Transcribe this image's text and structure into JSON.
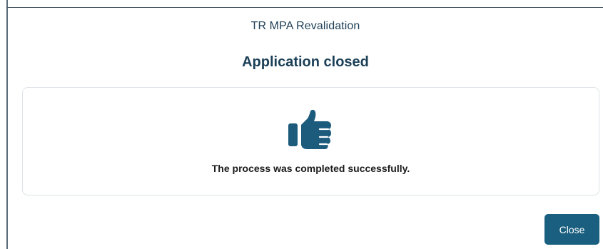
{
  "dialog": {
    "window_title": "TR MPA Revalidation",
    "heading": "Application closed",
    "message": "The process was completed successfully.",
    "icon": "thumbs-up-icon",
    "close_label": "Close"
  },
  "colors": {
    "accent": "#1a5f7f",
    "heading": "#1b3f57",
    "icon": "#1d5b7d"
  }
}
